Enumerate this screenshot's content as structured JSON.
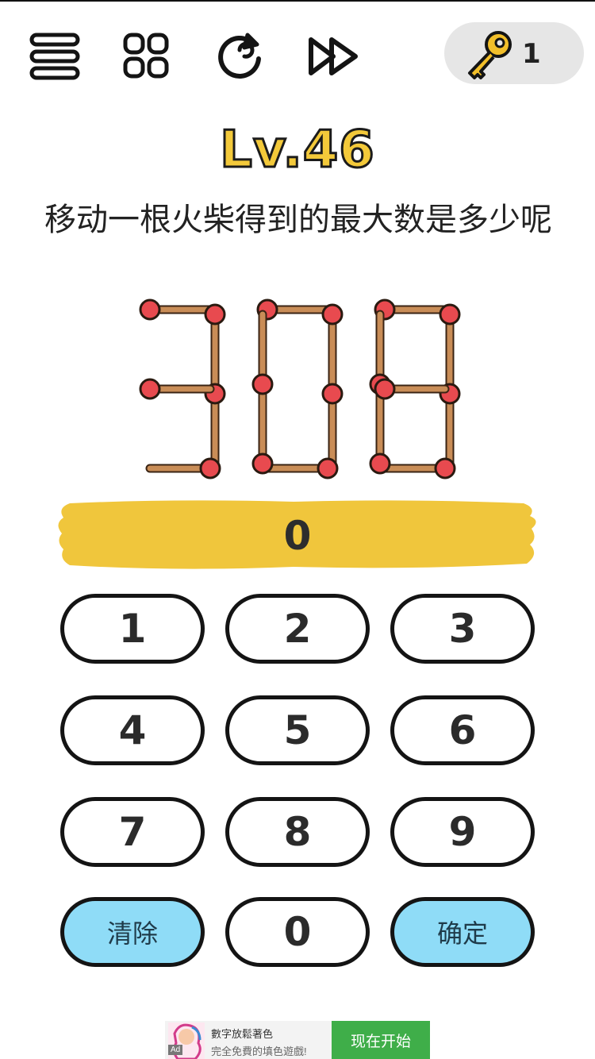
{
  "toolbar": {
    "icons": [
      "menu-icon",
      "grid-icon",
      "restart-icon",
      "skip-icon"
    ],
    "key_count": "1"
  },
  "level": {
    "label": "Lv.46"
  },
  "question": {
    "text": "移动一根火柴得到的最大数是多少呢"
  },
  "puzzle": {
    "digits": [
      "3",
      "0",
      "8"
    ],
    "match_colors": {
      "stick": "#c98d57",
      "head": "#e84a4f"
    }
  },
  "answer": {
    "value": "0",
    "bar_color": "#f0c63c"
  },
  "keypad": {
    "keys": [
      "1",
      "2",
      "3",
      "4",
      "5",
      "6",
      "7",
      "8",
      "9",
      "清除",
      "0",
      "确定"
    ],
    "action_color": "#8fdcf7"
  },
  "ad": {
    "title": "數字放鬆著色",
    "subtitle": "完全免費的填色遊戲!",
    "cta": "现在开始",
    "tag": "Ad"
  }
}
